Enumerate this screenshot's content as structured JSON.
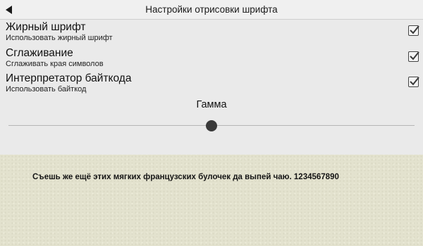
{
  "header": {
    "title": "Настройки отрисовки шрифта",
    "back_icon": "back-arrow-icon"
  },
  "settings": [
    {
      "title": "Жирный шрифт",
      "subtitle": "Использовать жирный шрифт",
      "checked": true
    },
    {
      "title": "Сглаживание",
      "subtitle": "Сглаживать края символов",
      "checked": true
    },
    {
      "title": "Интерпретатор байткода",
      "subtitle": "Использовать байткод",
      "checked": true
    }
  ],
  "gamma": {
    "label": "Гамма",
    "value_fraction": 0.5
  },
  "preview": {
    "text": "Съешь же ещё этих мягких французских булочек да выпей чаю. 1234567890"
  },
  "colors": {
    "background": "#eaeaea",
    "preview_background": "#e3e2ce",
    "thumb": "#3a3a3a"
  }
}
